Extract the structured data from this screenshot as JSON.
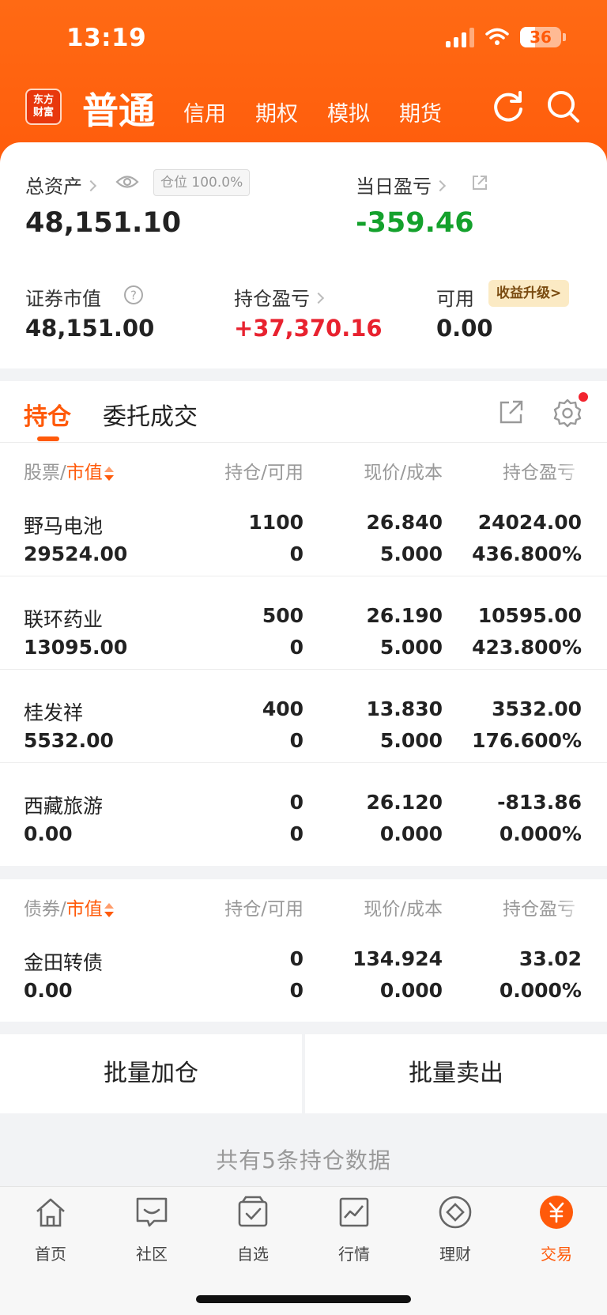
{
  "status": {
    "time": "13:19",
    "battery": "36",
    "battery_level": 0.36
  },
  "header": {
    "logo_line1": "东方",
    "logo_line2": "财富",
    "account_main": "普通",
    "tabs": [
      "信用",
      "期权",
      "模拟",
      "期货"
    ],
    "icons": [
      "refresh-icon",
      "search-icon"
    ]
  },
  "summary": {
    "total_assets_label": "总资产",
    "total_assets": "48,151.10",
    "position_badge": "仓位 100.0%",
    "daily_pl_label": "当日盈亏",
    "daily_pl": "-359.46",
    "market_value_label": "证券市值",
    "market_value": "48,151.00",
    "holding_pl_label": "持仓盈亏",
    "holding_pl": "+37,370.16",
    "available_label": "可用",
    "available": "0.00",
    "upgrade_label": "收益升级>"
  },
  "tabs": {
    "active": "持仓",
    "other": "委托成交"
  },
  "stocks": {
    "headers": {
      "name_prefix": "股票/",
      "name_accent": "市值",
      "qty": "持仓/可用",
      "price": "现价/成本",
      "pl": "持仓盈亏"
    },
    "rows": [
      {
        "name": "野马电池",
        "value": "29524.00",
        "qty": "1100",
        "avail": "0",
        "price": "26.840",
        "cost": "5.000",
        "pl": "24024.00",
        "pl_pct": "436.800%",
        "tone": "red"
      },
      {
        "name": "联环药业",
        "value": "13095.00",
        "qty": "500",
        "avail": "0",
        "price": "26.190",
        "cost": "5.000",
        "pl": "10595.00",
        "pl_pct": "423.800%",
        "tone": "red"
      },
      {
        "name": "桂发祥",
        "value": "5532.00",
        "qty": "400",
        "avail": "0",
        "price": "13.830",
        "cost": "5.000",
        "pl": "3532.00",
        "pl_pct": "176.600%",
        "tone": "red"
      },
      {
        "name": "西藏旅游",
        "value": "0.00",
        "qty": "0",
        "avail": "0",
        "price": "26.120",
        "cost": "0.000",
        "pl": "-813.86",
        "pl_pct": "0.000%",
        "tone": "green"
      }
    ]
  },
  "bonds": {
    "headers": {
      "name_prefix": "债券/",
      "name_accent": "市值",
      "qty": "持仓/可用",
      "price": "现价/成本",
      "pl": "持仓盈亏"
    },
    "rows": [
      {
        "name": "金田转债",
        "value": "0.00",
        "qty": "0",
        "avail": "0",
        "price": "134.924",
        "cost": "0.000",
        "pl": "33.02",
        "pl_pct": "0.000%",
        "tone": "red"
      }
    ]
  },
  "actions": {
    "batch_add": "批量加仓",
    "batch_sell": "批量卖出"
  },
  "footer_note": "共有5条持仓数据",
  "nav": [
    {
      "label": "首页",
      "icon": "home-icon"
    },
    {
      "label": "社区",
      "icon": "community-icon"
    },
    {
      "label": "自选",
      "icon": "watchlist-icon"
    },
    {
      "label": "行情",
      "icon": "market-icon"
    },
    {
      "label": "理财",
      "icon": "wealth-icon"
    },
    {
      "label": "交易",
      "icon": "trade-icon",
      "active": true
    }
  ],
  "colors": {
    "brand": "#ff5a0a",
    "up": "#e8222f",
    "down": "#14a12c"
  }
}
